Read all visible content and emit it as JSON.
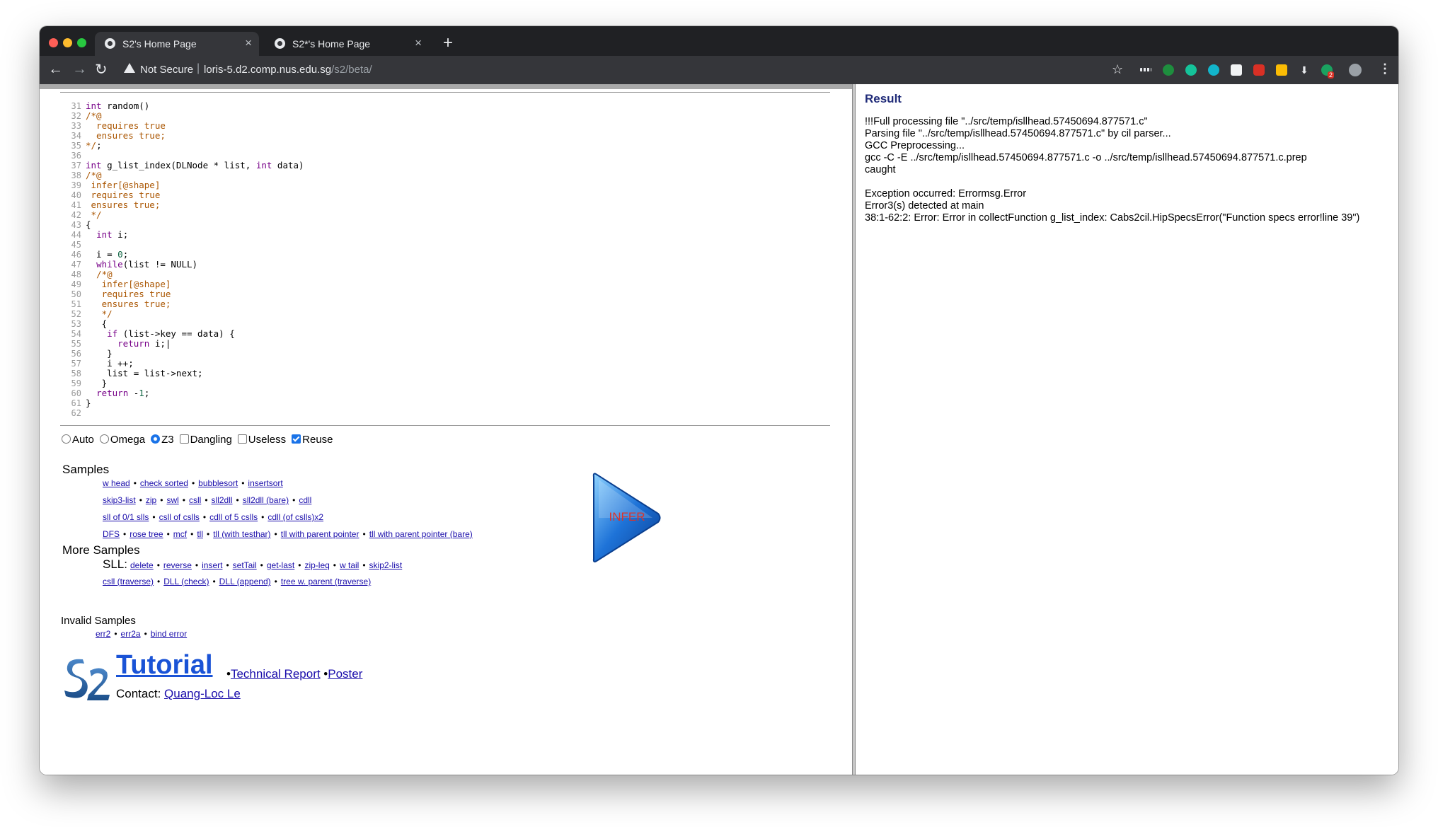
{
  "browser": {
    "tabs": [
      {
        "title": "S2's Home Page"
      },
      {
        "title": "S2*'s Home Page"
      }
    ],
    "security": "Not Secure",
    "url_host": "loris-5.d2.comp.nus.edu.sg",
    "url_path": "/s2/beta/",
    "extensions": [
      "dots-icon",
      "green-leaf-icon",
      "grammarly-icon",
      "m-icon",
      "image-icon",
      "shield-icon",
      "note-icon",
      "download-icon",
      "tab-icon",
      "badge-icon"
    ],
    "badge_count": "2"
  },
  "editor": {
    "line_numbers": [
      "31",
      "32",
      "33",
      "34",
      "35",
      "36",
      "37",
      "38",
      "39",
      "40",
      "41",
      "42",
      "43",
      "44",
      "45",
      "46",
      "47",
      "48",
      "49",
      "50",
      "51",
      "52",
      "53",
      "54",
      "55",
      "56",
      "57",
      "58",
      "59",
      "60",
      "61",
      "62"
    ]
  },
  "options": {
    "auto": "Auto",
    "omega": "Omega",
    "z3": "Z3",
    "dangling": "Dangling",
    "useless": "Useless",
    "reuse": "Reuse"
  },
  "samples": {
    "heading": "Samples",
    "row1": [
      "w head",
      "check sorted",
      "bubblesort",
      "insertsort"
    ],
    "row2": [
      "skip3-list",
      "zip",
      "swl",
      "csll",
      "sll2dll",
      "sll2dll (bare)",
      "cdll"
    ],
    "row3": [
      "sll of 0/1 slls",
      "csll of cslls",
      "cdll of 5 cslls",
      "cdll (of cslls)x2"
    ],
    "row4": [
      "DFS",
      "rose tree",
      "mcf",
      "tll",
      "tll (with testhar)",
      "tll with parent pointer",
      "tll with parent pointer (bare)"
    ]
  },
  "more_samples": {
    "heading": "More Samples",
    "sll_label": "SLL:",
    "row1": [
      "delete",
      "reverse",
      "insert",
      "setTail",
      "get-last",
      "zip-leq",
      "w tail",
      "skip2-list"
    ],
    "row2": [
      "csll (traverse)",
      "DLL (check)",
      "DLL (append)",
      "tree w. parent (traverse)"
    ]
  },
  "invalid": {
    "heading": "Invalid Samples",
    "items": [
      "err2",
      "err2a",
      "bind error"
    ]
  },
  "footer": {
    "tutorial": "Tutorial",
    "tech_report": "Technical Report",
    "poster": "Poster",
    "contact_label": "Contact:",
    "contact_name": "Quang-Loc Le"
  },
  "infer_button": "INFER",
  "result": {
    "title": "Result",
    "lines": [
      "!!!Full processing file \"../src/temp/isllhead.57450694.877571.c\"",
      "Parsing file \"../src/temp/isllhead.57450694.877571.c\" by cil parser...",
      "GCC Preprocessing...",
      "gcc -C -E ../src/temp/isllhead.57450694.877571.c -o ../src/temp/isllhead.57450694.877571.c.prep",
      "caught",
      "",
      "Exception occurred: Errormsg.Error",
      "Error3(s) detected at main",
      "38:1-62:2: Error: Error in collectFunction g_list_index: Cabs2cil.HipSpecsError(\"Function specs error!line 39\")"
    ]
  }
}
